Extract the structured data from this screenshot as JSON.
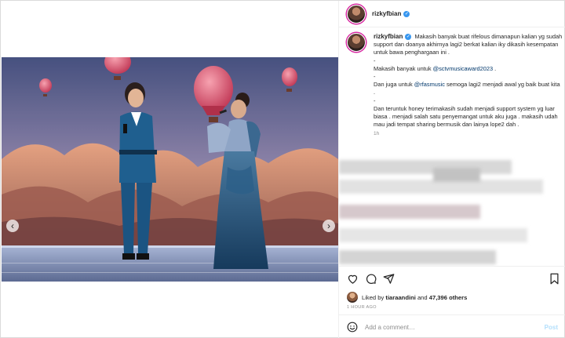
{
  "post": {
    "username": "rizkyfbian",
    "verified": true
  },
  "media": {
    "slide_count": 3,
    "active_slide": 1,
    "colors": {
      "sky": "#5a6a9c",
      "rock": "#c47a5e",
      "stage": "#c9d2e6",
      "balloon": "#e2536c",
      "suit": "#1f5f8f",
      "gown": "#1e4f78"
    }
  },
  "caption": {
    "username": "rizkyfbian",
    "lines": [
      [
        {
          "t": "Makasih banyak buat rifelous dimanapun kalian yg sudah support dan doanya akhirnya lagi2 berkat kalian iky dikasih kesempatan untuk bawa penghargaan ini .",
          "m": false
        }
      ],
      [
        {
          "t": "-",
          "m": false
        }
      ],
      [
        {
          "t": "Makasih banyak untuk ",
          "m": false
        },
        {
          "t": "@sctvmusicaward2023",
          "m": true
        },
        {
          "t": " .",
          "m": false
        }
      ],
      [
        {
          "t": "-",
          "m": false
        }
      ],
      [
        {
          "t": "Dan juga untuk ",
          "m": false
        },
        {
          "t": "@rfasmusic",
          "m": true
        },
        {
          "t": " semoga lagi2 menjadi awal yg baik buat kita .",
          "m": false
        }
      ],
      [
        {
          "t": "-",
          "m": false
        }
      ],
      [
        {
          "t": "Dan teruntuk honey terimakasih sudah menjadi support system yg luar biasa . menjadi salah satu penyemangat untuk aku juga . makasih udah mau jadi tempat sharing bermusik dan lainya lope2 dah .",
          "m": false
        }
      ]
    ],
    "time": "1h"
  },
  "actions": {
    "liked_by_prefix": "Liked by",
    "liked_by_user": "tiaraandini",
    "and_text": "and",
    "others": "47,396 others",
    "timestamp": "1 HOUR AGO"
  },
  "comment_box": {
    "placeholder": "Add a comment…",
    "post_label": "Post",
    "post_color": "#b2dffc"
  },
  "icons": [
    "verified-badge-icon",
    "heart-icon",
    "comment-icon",
    "share-icon",
    "bookmark-icon",
    "emoji-icon",
    "chevron-left-icon",
    "chevron-right-icon"
  ]
}
